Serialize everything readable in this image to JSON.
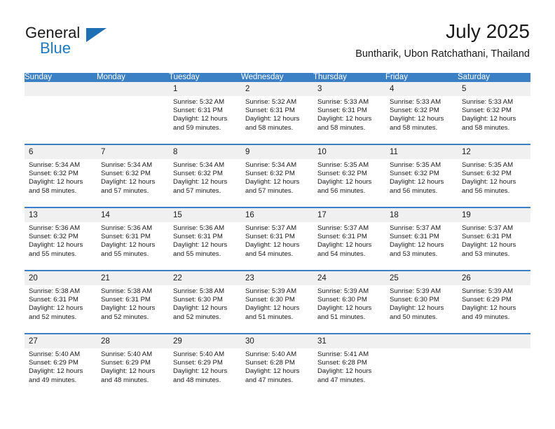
{
  "brand": {
    "word_one": "General",
    "word_two": "Blue",
    "logo_icon": "triangle-logo-icon",
    "accent_color": "#1f6fb4"
  },
  "header": {
    "title": "July 2025",
    "subtitle": "Buntharik, Ubon Ratchathani, Thailand"
  },
  "theme": {
    "header_blue": "#3b7fc4",
    "daynum_gray": "#f0f0f0",
    "text": "#1a1a1a"
  },
  "calendar": {
    "weekday_headers": [
      "Sunday",
      "Monday",
      "Tuesday",
      "Wednesday",
      "Thursday",
      "Friday",
      "Saturday"
    ],
    "weeks": [
      [
        {
          "day": "",
          "sunrise": "",
          "sunset": "",
          "daylight_line1": "",
          "daylight_line2": ""
        },
        {
          "day": "",
          "sunrise": "",
          "sunset": "",
          "daylight_line1": "",
          "daylight_line2": ""
        },
        {
          "day": "1",
          "sunrise": "Sunrise: 5:32 AM",
          "sunset": "Sunset: 6:31 PM",
          "daylight_line1": "Daylight: 12 hours",
          "daylight_line2": "and 59 minutes."
        },
        {
          "day": "2",
          "sunrise": "Sunrise: 5:32 AM",
          "sunset": "Sunset: 6:31 PM",
          "daylight_line1": "Daylight: 12 hours",
          "daylight_line2": "and 58 minutes."
        },
        {
          "day": "3",
          "sunrise": "Sunrise: 5:33 AM",
          "sunset": "Sunset: 6:31 PM",
          "daylight_line1": "Daylight: 12 hours",
          "daylight_line2": "and 58 minutes."
        },
        {
          "day": "4",
          "sunrise": "Sunrise: 5:33 AM",
          "sunset": "Sunset: 6:32 PM",
          "daylight_line1": "Daylight: 12 hours",
          "daylight_line2": "and 58 minutes."
        },
        {
          "day": "5",
          "sunrise": "Sunrise: 5:33 AM",
          "sunset": "Sunset: 6:32 PM",
          "daylight_line1": "Daylight: 12 hours",
          "daylight_line2": "and 58 minutes."
        }
      ],
      [
        {
          "day": "6",
          "sunrise": "Sunrise: 5:34 AM",
          "sunset": "Sunset: 6:32 PM",
          "daylight_line1": "Daylight: 12 hours",
          "daylight_line2": "and 58 minutes."
        },
        {
          "day": "7",
          "sunrise": "Sunrise: 5:34 AM",
          "sunset": "Sunset: 6:32 PM",
          "daylight_line1": "Daylight: 12 hours",
          "daylight_line2": "and 57 minutes."
        },
        {
          "day": "8",
          "sunrise": "Sunrise: 5:34 AM",
          "sunset": "Sunset: 6:32 PM",
          "daylight_line1": "Daylight: 12 hours",
          "daylight_line2": "and 57 minutes."
        },
        {
          "day": "9",
          "sunrise": "Sunrise: 5:34 AM",
          "sunset": "Sunset: 6:32 PM",
          "daylight_line1": "Daylight: 12 hours",
          "daylight_line2": "and 57 minutes."
        },
        {
          "day": "10",
          "sunrise": "Sunrise: 5:35 AM",
          "sunset": "Sunset: 6:32 PM",
          "daylight_line1": "Daylight: 12 hours",
          "daylight_line2": "and 56 minutes."
        },
        {
          "day": "11",
          "sunrise": "Sunrise: 5:35 AM",
          "sunset": "Sunset: 6:32 PM",
          "daylight_line1": "Daylight: 12 hours",
          "daylight_line2": "and 56 minutes."
        },
        {
          "day": "12",
          "sunrise": "Sunrise: 5:35 AM",
          "sunset": "Sunset: 6:32 PM",
          "daylight_line1": "Daylight: 12 hours",
          "daylight_line2": "and 56 minutes."
        }
      ],
      [
        {
          "day": "13",
          "sunrise": "Sunrise: 5:36 AM",
          "sunset": "Sunset: 6:32 PM",
          "daylight_line1": "Daylight: 12 hours",
          "daylight_line2": "and 55 minutes."
        },
        {
          "day": "14",
          "sunrise": "Sunrise: 5:36 AM",
          "sunset": "Sunset: 6:31 PM",
          "daylight_line1": "Daylight: 12 hours",
          "daylight_line2": "and 55 minutes."
        },
        {
          "day": "15",
          "sunrise": "Sunrise: 5:36 AM",
          "sunset": "Sunset: 6:31 PM",
          "daylight_line1": "Daylight: 12 hours",
          "daylight_line2": "and 55 minutes."
        },
        {
          "day": "16",
          "sunrise": "Sunrise: 5:37 AM",
          "sunset": "Sunset: 6:31 PM",
          "daylight_line1": "Daylight: 12 hours",
          "daylight_line2": "and 54 minutes."
        },
        {
          "day": "17",
          "sunrise": "Sunrise: 5:37 AM",
          "sunset": "Sunset: 6:31 PM",
          "daylight_line1": "Daylight: 12 hours",
          "daylight_line2": "and 54 minutes."
        },
        {
          "day": "18",
          "sunrise": "Sunrise: 5:37 AM",
          "sunset": "Sunset: 6:31 PM",
          "daylight_line1": "Daylight: 12 hours",
          "daylight_line2": "and 53 minutes."
        },
        {
          "day": "19",
          "sunrise": "Sunrise: 5:37 AM",
          "sunset": "Sunset: 6:31 PM",
          "daylight_line1": "Daylight: 12 hours",
          "daylight_line2": "and 53 minutes."
        }
      ],
      [
        {
          "day": "20",
          "sunrise": "Sunrise: 5:38 AM",
          "sunset": "Sunset: 6:31 PM",
          "daylight_line1": "Daylight: 12 hours",
          "daylight_line2": "and 52 minutes."
        },
        {
          "day": "21",
          "sunrise": "Sunrise: 5:38 AM",
          "sunset": "Sunset: 6:31 PM",
          "daylight_line1": "Daylight: 12 hours",
          "daylight_line2": "and 52 minutes."
        },
        {
          "day": "22",
          "sunrise": "Sunrise: 5:38 AM",
          "sunset": "Sunset: 6:30 PM",
          "daylight_line1": "Daylight: 12 hours",
          "daylight_line2": "and 52 minutes."
        },
        {
          "day": "23",
          "sunrise": "Sunrise: 5:39 AM",
          "sunset": "Sunset: 6:30 PM",
          "daylight_line1": "Daylight: 12 hours",
          "daylight_line2": "and 51 minutes."
        },
        {
          "day": "24",
          "sunrise": "Sunrise: 5:39 AM",
          "sunset": "Sunset: 6:30 PM",
          "daylight_line1": "Daylight: 12 hours",
          "daylight_line2": "and 51 minutes."
        },
        {
          "day": "25",
          "sunrise": "Sunrise: 5:39 AM",
          "sunset": "Sunset: 6:30 PM",
          "daylight_line1": "Daylight: 12 hours",
          "daylight_line2": "and 50 minutes."
        },
        {
          "day": "26",
          "sunrise": "Sunrise: 5:39 AM",
          "sunset": "Sunset: 6:29 PM",
          "daylight_line1": "Daylight: 12 hours",
          "daylight_line2": "and 49 minutes."
        }
      ],
      [
        {
          "day": "27",
          "sunrise": "Sunrise: 5:40 AM",
          "sunset": "Sunset: 6:29 PM",
          "daylight_line1": "Daylight: 12 hours",
          "daylight_line2": "and 49 minutes."
        },
        {
          "day": "28",
          "sunrise": "Sunrise: 5:40 AM",
          "sunset": "Sunset: 6:29 PM",
          "daylight_line1": "Daylight: 12 hours",
          "daylight_line2": "and 48 minutes."
        },
        {
          "day": "29",
          "sunrise": "Sunrise: 5:40 AM",
          "sunset": "Sunset: 6:29 PM",
          "daylight_line1": "Daylight: 12 hours",
          "daylight_line2": "and 48 minutes."
        },
        {
          "day": "30",
          "sunrise": "Sunrise: 5:40 AM",
          "sunset": "Sunset: 6:28 PM",
          "daylight_line1": "Daylight: 12 hours",
          "daylight_line2": "and 47 minutes."
        },
        {
          "day": "31",
          "sunrise": "Sunrise: 5:41 AM",
          "sunset": "Sunset: 6:28 PM",
          "daylight_line1": "Daylight: 12 hours",
          "daylight_line2": "and 47 minutes."
        },
        {
          "day": "",
          "sunrise": "",
          "sunset": "",
          "daylight_line1": "",
          "daylight_line2": ""
        },
        {
          "day": "",
          "sunrise": "",
          "sunset": "",
          "daylight_line1": "",
          "daylight_line2": ""
        }
      ]
    ]
  }
}
